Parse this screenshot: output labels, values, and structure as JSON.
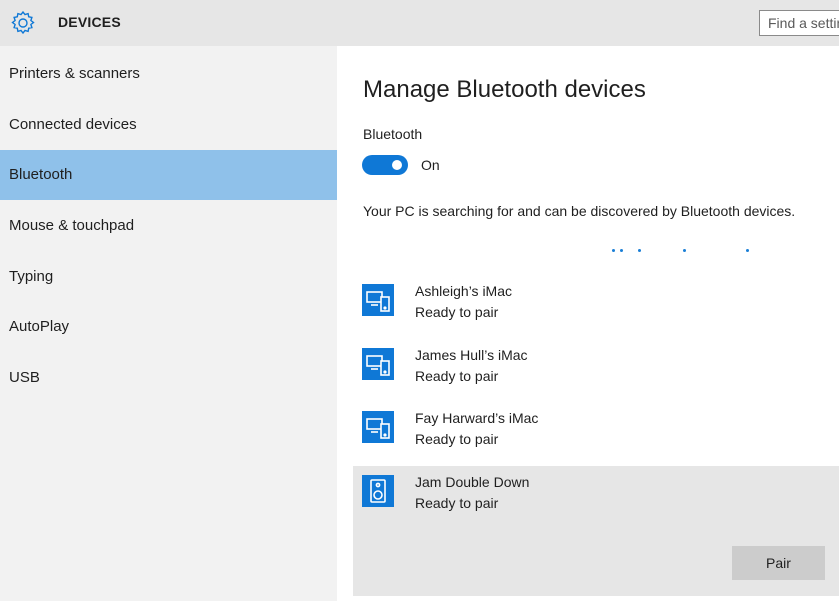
{
  "header": {
    "title": "DEVICES",
    "icon": "gear-icon",
    "search_placeholder": "Find a setting"
  },
  "sidebar": {
    "items": [
      {
        "label": "Printers & scanners",
        "selected": false
      },
      {
        "label": "Connected devices",
        "selected": false
      },
      {
        "label": "Bluetooth",
        "selected": true
      },
      {
        "label": "Mouse & touchpad",
        "selected": false
      },
      {
        "label": "Typing",
        "selected": false
      },
      {
        "label": "AutoPlay",
        "selected": false
      },
      {
        "label": "USB",
        "selected": false
      }
    ]
  },
  "main": {
    "heading": "Manage Bluetooth devices",
    "bluetooth_label": "Bluetooth",
    "toggle_state": "On",
    "toggle_on": true,
    "status_text": "Your PC is searching for and can be discovered by Bluetooth devices.",
    "devices": [
      {
        "name": "Ashleigh’s iMac",
        "status": "Ready to pair",
        "icon": "computer-phone-icon"
      },
      {
        "name": "James Hull’s iMac",
        "status": "Ready to pair",
        "icon": "computer-phone-icon"
      },
      {
        "name": "Fay Harward’s iMac",
        "status": "Ready to pair",
        "icon": "computer-phone-icon"
      },
      {
        "name": "Jam Double Down",
        "status": "Ready to pair",
        "icon": "speaker-icon",
        "selected": true
      }
    ],
    "pair_button": "Pair"
  },
  "colors": {
    "accent": "#0f78d6",
    "sidebar_selected": "#8fc1ea",
    "header_bg": "#e6e6e6",
    "selected_row_bg": "#e6e6e6"
  }
}
